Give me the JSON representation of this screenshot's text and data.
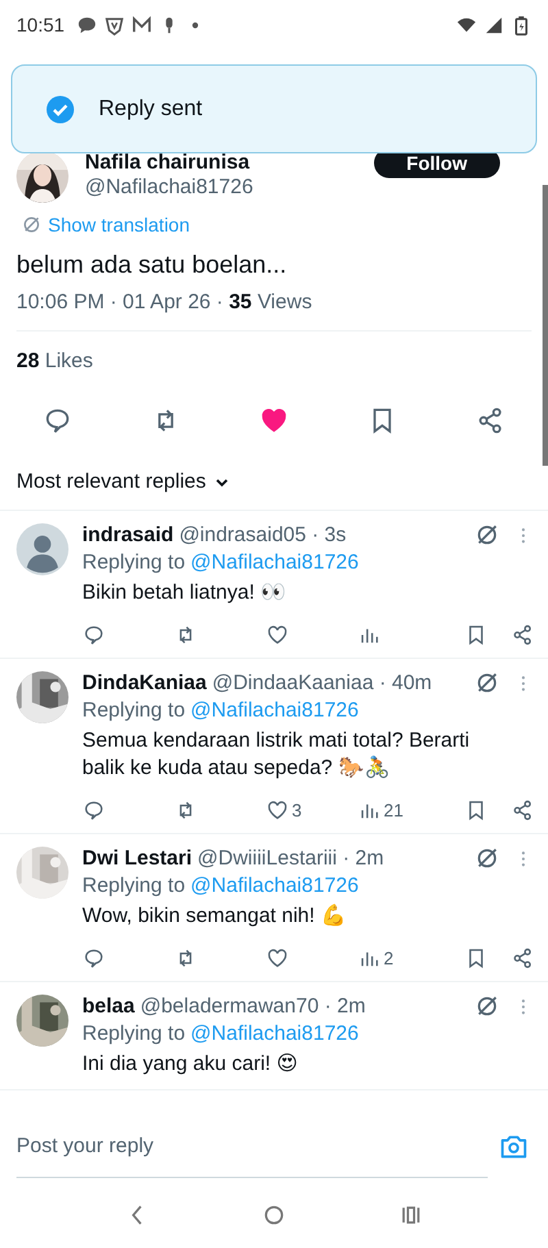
{
  "status_bar": {
    "time": "10:51"
  },
  "toast": {
    "text": "Reply sent",
    "success": true
  },
  "tweet": {
    "author": "Nafila chairunisa",
    "handle": "@Nafilachai81726",
    "follow_label": "Follow",
    "translate_label": "Show translation",
    "text": "belum ada satu boelan...",
    "meta": "10:06 PM · 01 Apr 26 · **35** Views",
    "likes": "**28** Likes",
    "liked": true,
    "bookmarked": false
  },
  "sort": {
    "label": "Most relevant replies"
  },
  "replies": [
    {
      "name": "indrasaid",
      "handle_time": "@indrasaid05 · 3s",
      "avatar": {
        "kind": "default"
      },
      "replying_label": "Replying to",
      "replying_to": "@Nafilachai81726",
      "text": "Bikin betah liatnya! 👀",
      "actions": {
        "liked": false
      }
    },
    {
      "name": "DindaKaniaa",
      "handle_time": "@DindaaKaaniaa · 40m",
      "replying_label": "Replying to",
      "replying_to": "@Nafilachai81726",
      "text": "Semua kendaraan listrik mati total? Berarti balik ke kuda atau sepeda? 🐎🚴",
      "actions": {
        "liked": false,
        "like_count": "3",
        "view_count": "21"
      }
    },
    {
      "name": "Dwi Lestari",
      "handle_time": "@DwiiiiLestariii · 2m",
      "replying_label": "Replying to",
      "replying_to": "@Nafilachai81726",
      "text": "Wow, bikin semangat nih! 💪",
      "actions": {
        "liked": false,
        "view_count": "2"
      }
    },
    {
      "name": "belaa",
      "handle_time": "@beladermawan70 · 2m",
      "replying_label": "Replying to",
      "replying_to": "@Nafilachai81726",
      "text": "Ini dia yang aku cari! 😍"
    }
  ],
  "composer": {
    "placeholder": "Post your reply"
  }
}
